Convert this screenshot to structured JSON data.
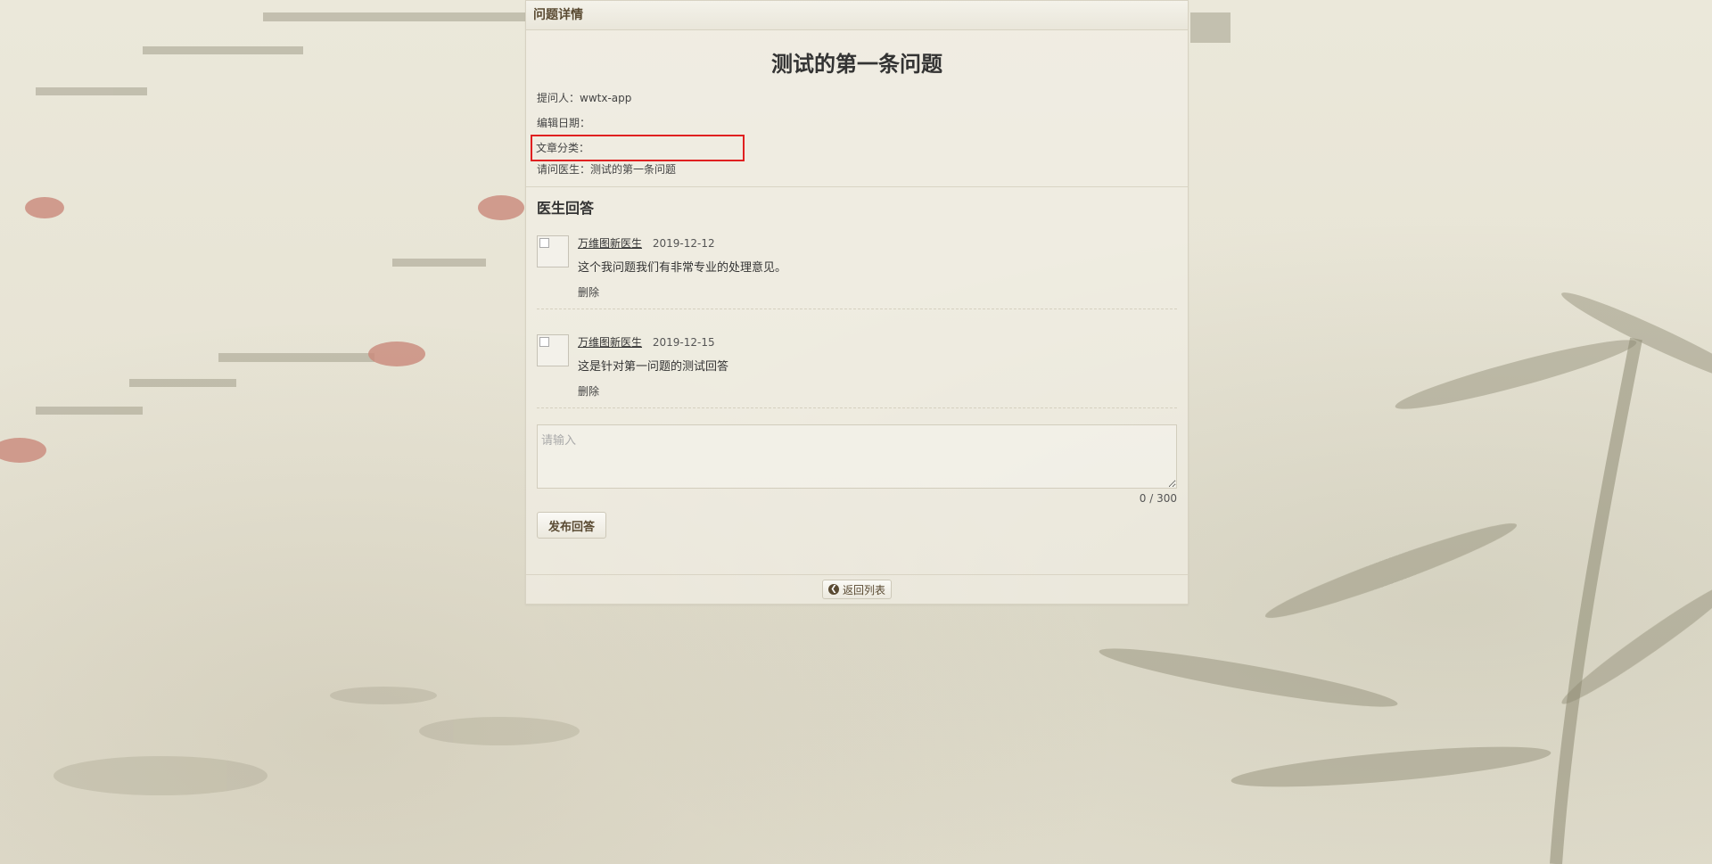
{
  "panel": {
    "header_title": "问题详情"
  },
  "question": {
    "title": "测试的第一条问题",
    "asker_label": "提问人：",
    "asker_value": "wwtx-app",
    "edit_date_label": "编辑日期：",
    "edit_date_value": "",
    "category_label": "文章分类：",
    "category_value": "",
    "ask_doctor_label": "请问医生：",
    "ask_doctor_value": "测试的第一条问题"
  },
  "answers": {
    "section_title": "医生回答",
    "items": [
      {
        "doctor": "万维图新医生",
        "date": "2019-12-12",
        "text": "这个我问题我们有非常专业的处理意见。",
        "delete_label": "删除"
      },
      {
        "doctor": "万维图新医生",
        "date": "2019-12-15",
        "text": "这是针对第一问题的测试回答",
        "delete_label": "删除"
      }
    ]
  },
  "reply": {
    "placeholder": "请输入",
    "value": "",
    "counter": "0 / 300",
    "submit_label": "发布回答"
  },
  "footer": {
    "back_label": "返回列表",
    "back_icon": "arrow-left-circle-icon"
  },
  "colors": {
    "highlight_border": "#e02020",
    "accent_text": "#5a4a32"
  }
}
